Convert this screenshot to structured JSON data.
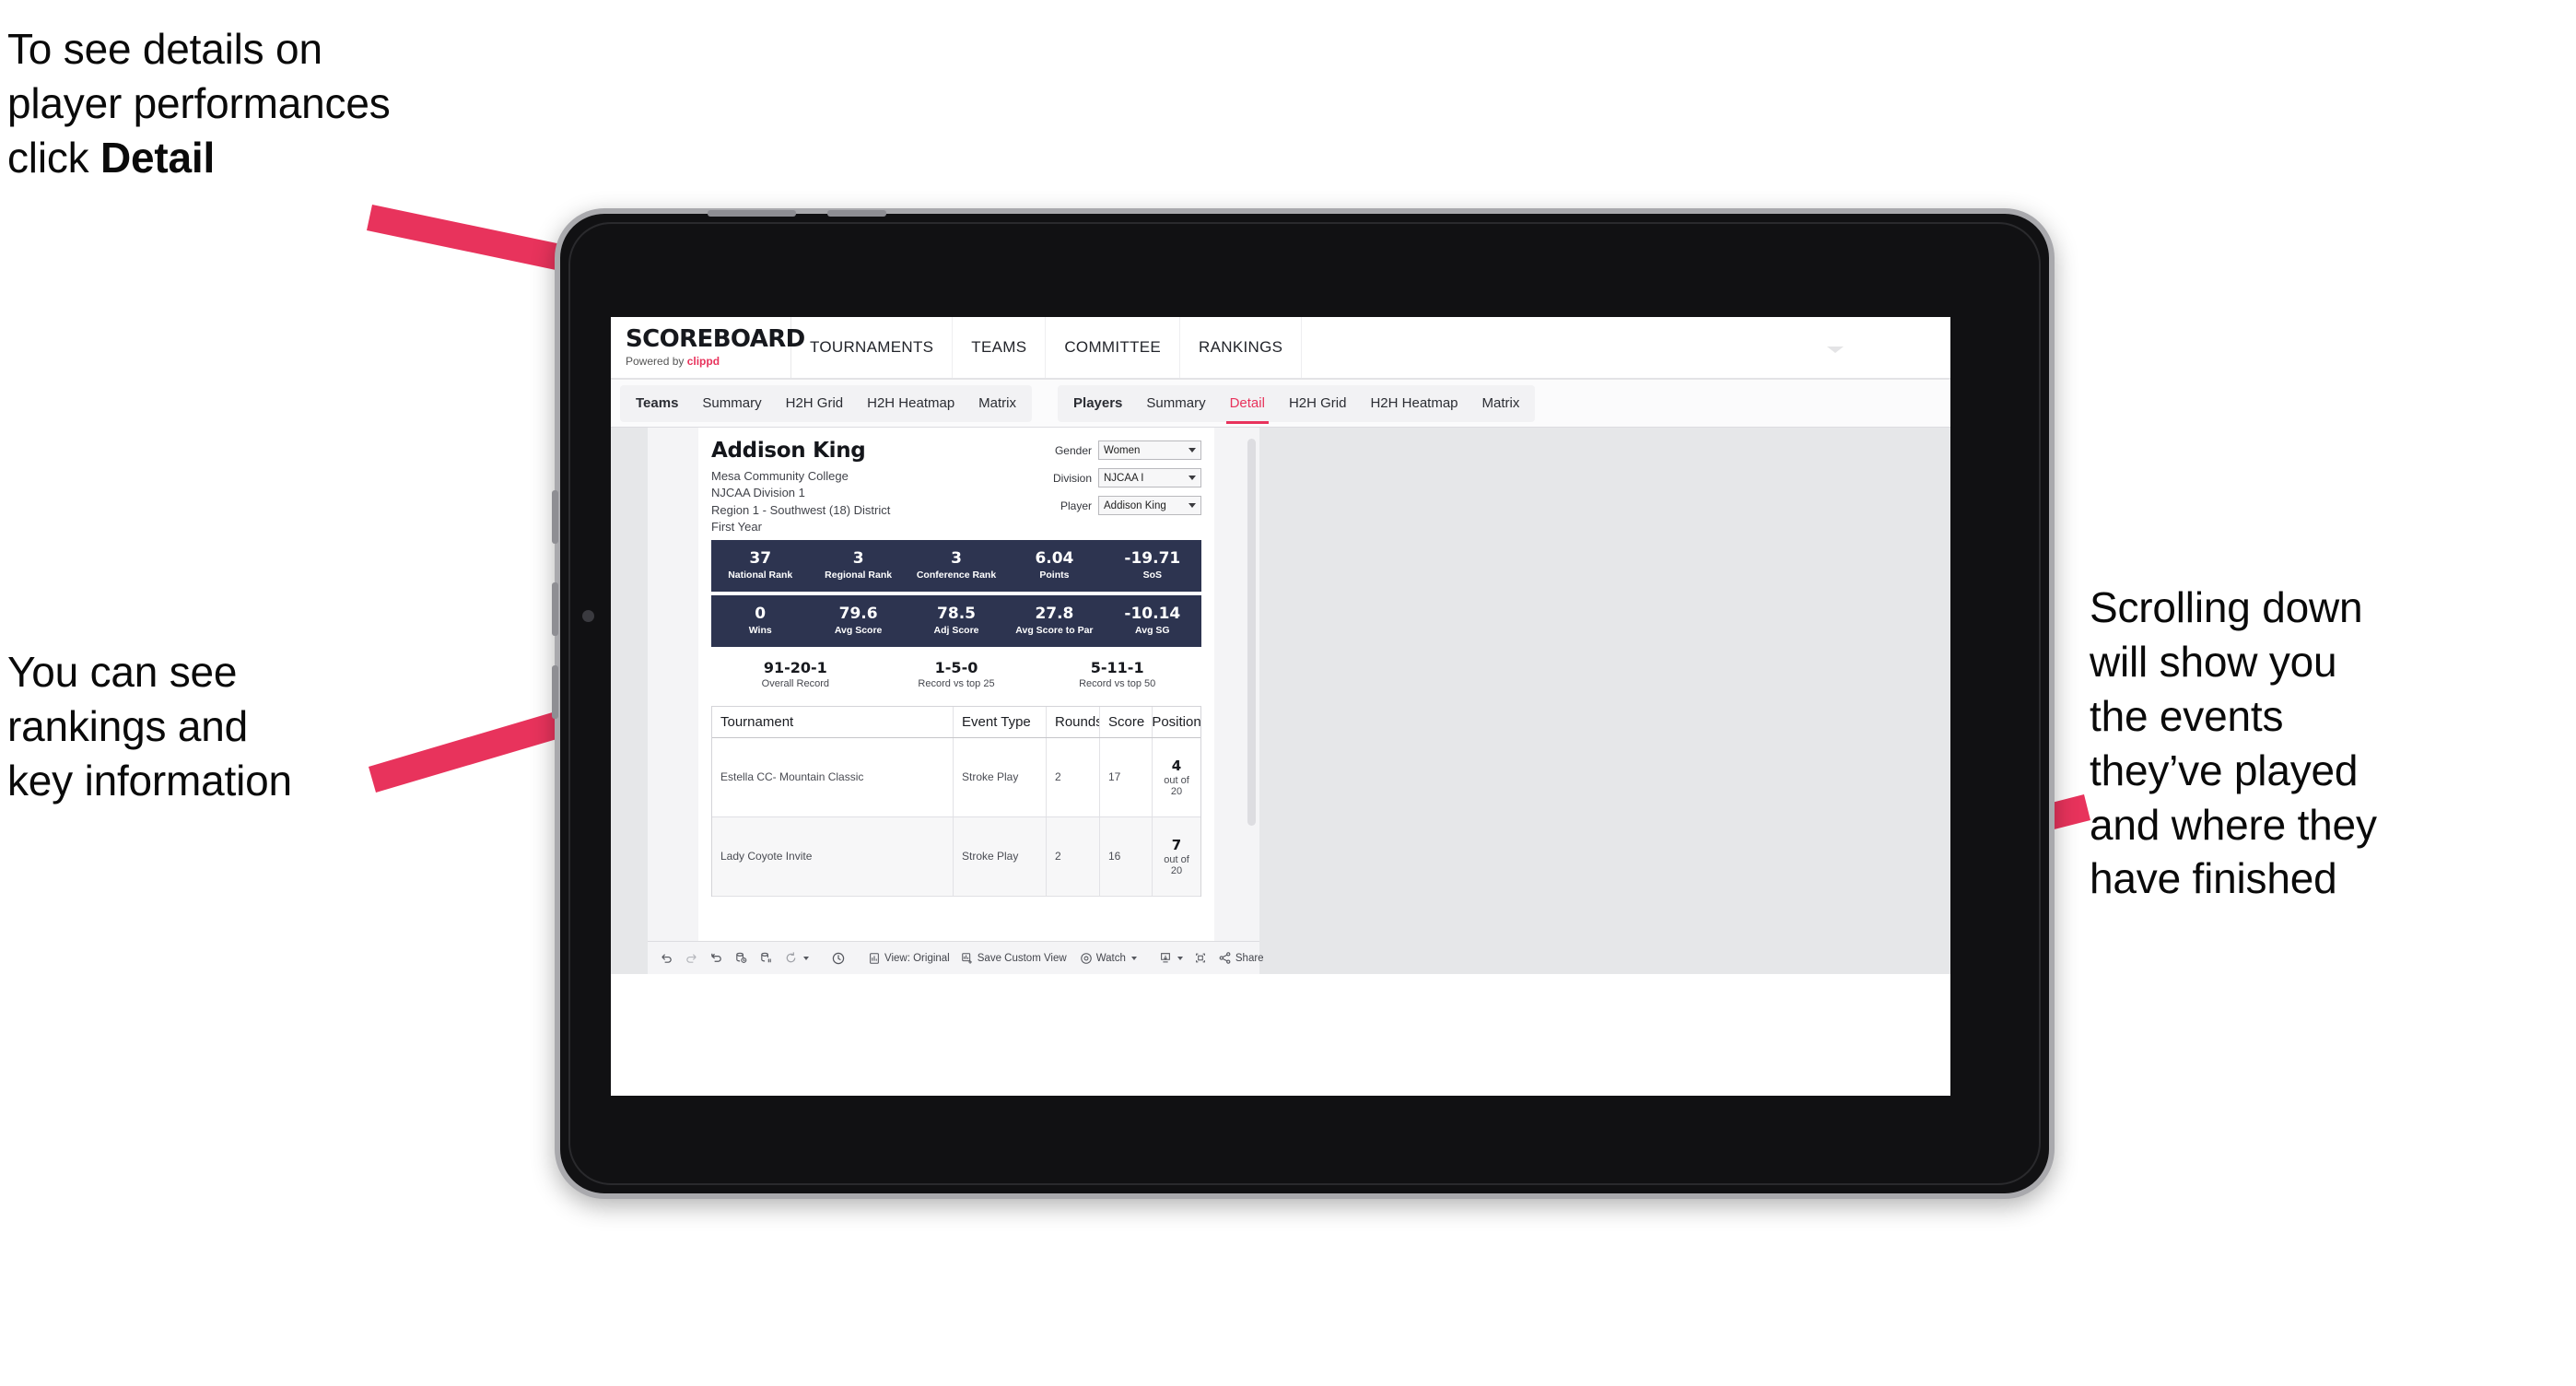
{
  "annotations": {
    "top_left": "To see details on\nplayer performances\nclick ",
    "top_left_bold": "Detail",
    "left": "You can see\nrankings and\nkey information",
    "right": "Scrolling down\nwill show you\nthe events\nthey’ve played\nand where they\nhave finished"
  },
  "accent_color": "#e8335c",
  "navy_color": "#2d3450",
  "header": {
    "brand_title": "SCOREBOARD",
    "brand_sub_prefix": "Powered by ",
    "brand_sub_name": "clippd",
    "nav": [
      {
        "label": "TOURNAMENTS"
      },
      {
        "label": "TEAMS"
      },
      {
        "label": "COMMITTEE"
      },
      {
        "label": "RANKINGS"
      }
    ]
  },
  "tabs": {
    "team_group": [
      {
        "label": "Teams",
        "active": false,
        "head": true
      },
      {
        "label": "Summary",
        "active": false
      },
      {
        "label": "H2H Grid",
        "active": false
      },
      {
        "label": "H2H Heatmap",
        "active": false
      },
      {
        "label": "Matrix",
        "active": false
      }
    ],
    "player_group": [
      {
        "label": "Players",
        "active": false,
        "head": true
      },
      {
        "label": "Summary",
        "active": false
      },
      {
        "label": "Detail",
        "active": true
      },
      {
        "label": "H2H Grid",
        "active": false
      },
      {
        "label": "H2H Heatmap",
        "active": false
      },
      {
        "label": "Matrix",
        "active": false
      }
    ]
  },
  "player": {
    "name": "Addison King",
    "school": "Mesa Community College",
    "division": "NJCAA Division 1",
    "region": "Region 1 - Southwest (18) District",
    "year": "First Year"
  },
  "filters": [
    {
      "label": "Gender",
      "value": "Women"
    },
    {
      "label": "Division",
      "value": "NJCAA I"
    },
    {
      "label": "Player",
      "value": "Addison King"
    }
  ],
  "stats_row1": [
    {
      "value": "37",
      "label": "National Rank"
    },
    {
      "value": "3",
      "label": "Regional Rank"
    },
    {
      "value": "3",
      "label": "Conference Rank"
    },
    {
      "value": "6.04",
      "label": "Points"
    },
    {
      "value": "-19.71",
      "label": "SoS"
    }
  ],
  "stats_row2": [
    {
      "value": "0",
      "label": "Wins"
    },
    {
      "value": "79.6",
      "label": "Avg Score"
    },
    {
      "value": "78.5",
      "label": "Adj Score"
    },
    {
      "value": "27.8",
      "label": "Avg Score to Par"
    },
    {
      "value": "-10.14",
      "label": "Avg SG"
    }
  ],
  "records": [
    {
      "value": "91-20-1",
      "label": "Overall Record"
    },
    {
      "value": "1-5-0",
      "label": "Record vs top 25"
    },
    {
      "value": "5-11-1",
      "label": "Record vs top 50"
    }
  ],
  "table": {
    "columns": [
      "Tournament",
      "Event Type",
      "Rounds",
      "Score",
      "Position"
    ],
    "rows": [
      {
        "tournament": "Estella CC- Mountain Classic",
        "event_type": "Stroke Play",
        "rounds": "2",
        "score": "17",
        "position": "4",
        "position_sub": "out of 20"
      },
      {
        "tournament": "Lady Coyote Invite",
        "event_type": "Stroke Play",
        "rounds": "2",
        "score": "16",
        "position": "7",
        "position_sub": "out of 20"
      }
    ]
  },
  "toolbar": {
    "view_label": "View: Original",
    "save_label": "Save Custom View",
    "watch_label": "Watch",
    "share_label": "Share"
  }
}
